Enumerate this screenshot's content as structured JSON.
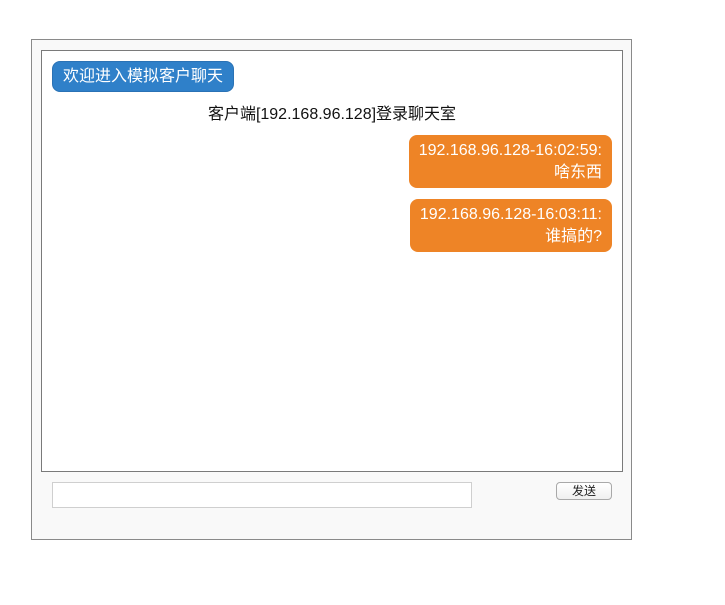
{
  "header": {
    "welcome_label": "欢迎进入模拟客户聊天"
  },
  "chat": {
    "system_message": "客户端[192.168.96.128]登录聊天室",
    "messages": [
      {
        "sender": "192.168.96.128-16:02:59:",
        "text": "啥东西"
      },
      {
        "sender": "192.168.96.128-16:03:11:",
        "text": "谁搞的?"
      }
    ]
  },
  "composer": {
    "send_label": "发送"
  },
  "colors": {
    "welcome_bubble": "#2f80c9",
    "message_bubble": "#ee8426"
  }
}
